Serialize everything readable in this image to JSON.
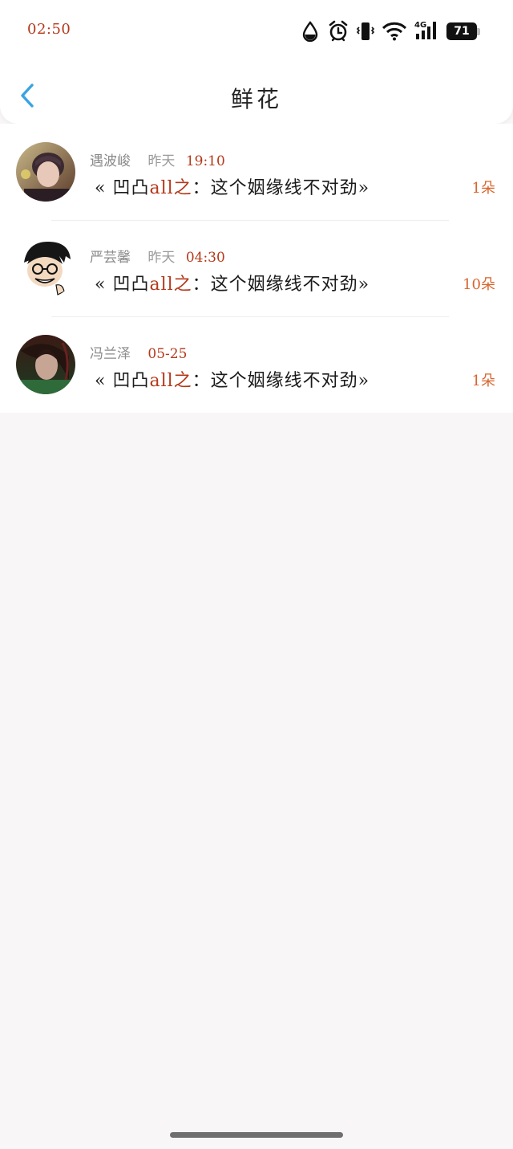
{
  "status_bar": {
    "time": "02:50",
    "battery": "71",
    "network": "4G",
    "icons": [
      "drop-icon",
      "alarm-icon",
      "vibrate-icon",
      "wifi-icon",
      "signal-icon",
      "battery-icon"
    ]
  },
  "header": {
    "title": "鲜花",
    "back_icon": "chevron-left-icon",
    "accent": "#3aa3e3"
  },
  "records": [
    {
      "user": "遇波峻",
      "day": "昨天",
      "time": "19:10",
      "book_prefix": "« 凹凸",
      "book_highlight": "all之",
      "book_suffix": "：这个姻缘线不对劲»",
      "amount": "1朵"
    },
    {
      "user": "严芸馨",
      "day": "昨天",
      "time": "04:30",
      "book_prefix": "« 凹凸",
      "book_highlight": "all之",
      "book_suffix": "：这个姻缘线不对劲»",
      "amount": "10朵"
    },
    {
      "user": "冯兰泽",
      "day": "",
      "time": "05-25",
      "book_prefix": "« 凹凸",
      "book_highlight": "all之",
      "book_suffix": "：这个姻缘线不对劲»",
      "amount": "1朵"
    }
  ],
  "colors": {
    "highlight": "#b5381a",
    "amount": "#d8652e",
    "background": "#f8f6f6"
  }
}
